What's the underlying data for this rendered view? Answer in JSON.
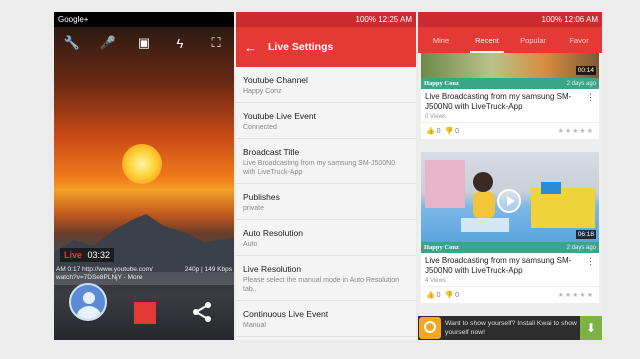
{
  "camera": {
    "status_left": "Google+",
    "status_icon": "notification-icon",
    "toolbar_icons": [
      "wrench-icon",
      "microphone-icon",
      "video-camera-icon",
      "flash-off-icon",
      "focus-icon"
    ],
    "live_label": "Live",
    "live_time": "03:32",
    "info_line1": "AM 0:17  http://www.youtube.com/",
    "info_line2": "watch?v=7DSe8PLNjY - More",
    "resolution": "240p | 149 Kbps"
  },
  "settings": {
    "status_right": "100% 12:25 AM",
    "title": "Live Settings",
    "items": [
      {
        "label": "Youtube Channel",
        "value": "Happy Conz"
      },
      {
        "label": "Youtube Live Event",
        "value": "Connected"
      },
      {
        "label": "Broadcast Title",
        "value": "Live Broadcasting from my samsung SM-J500N0 with LiveTruck-App"
      },
      {
        "label": "Publishes",
        "value": "private"
      },
      {
        "label": "Auto Resolution",
        "value": "Auto"
      },
      {
        "label": "Live Resolution",
        "value": "Please select the manual mode in Auto Resolution tab.."
      },
      {
        "label": "Continuous Live Event",
        "value": "Manual"
      }
    ]
  },
  "videos": {
    "status_right": "100% 12:06 AM",
    "tabs": [
      "Mine",
      "Recent",
      "Popular",
      "Favor"
    ],
    "active_tab": "Recent",
    "items": [
      {
        "duration": "00:14",
        "channel": "Happy Conz",
        "ago": "2 days ago",
        "title": "Live Broadcasting from my samsung SM-J500N0 with LiveTruck-App",
        "views": "0 Views",
        "likes": "0",
        "dislikes": "0"
      },
      {
        "duration": "06:18",
        "channel": "Happy Conz",
        "ago": "2 days ago",
        "title": "Live Broadcasting from my samsung SM-J500N0 with LiveTruck-App",
        "views": "4 Views",
        "likes": "0",
        "dislikes": "0"
      }
    ],
    "ad_text": "Want to show yourself? Install Kwai to show yourself now!",
    "stars": "★★★★★"
  },
  "colors": {
    "accent": "#e53935",
    "channel_bar": "#3aa687"
  }
}
